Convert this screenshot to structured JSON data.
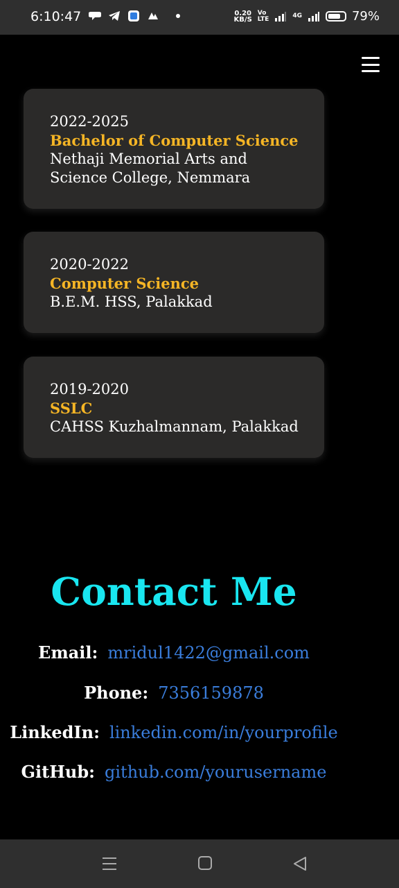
{
  "status_bar": {
    "time": "6:10:47",
    "speed_value": "0.20",
    "speed_unit": "KB/S",
    "volte_top": "Vo",
    "volte_bottom": "LTE",
    "network": "4G",
    "battery_percent": "79%",
    "battery_level": 0.79,
    "icons": [
      "chat-icon",
      "telegram-icon",
      "app-icon",
      "vpn-icon",
      "notification-dot"
    ]
  },
  "header": {
    "menu_icon": "hamburger-menu-icon"
  },
  "education": [
    {
      "year": "2022-2025",
      "degree": "Bachelor of Computer Science",
      "school_line1": "Nethaji Memorial Arts and",
      "school_line2": "Science College, Nemmara"
    },
    {
      "year": "2020-2022",
      "degree": "Computer Science",
      "school_line1": "B.E.M. HSS, Palakkad"
    },
    {
      "year": "2019-2020",
      "degree": "SSLC",
      "school_line1": "CAHSS Kuzhalmannam, Palakkad"
    }
  ],
  "contact": {
    "title": "Contact Me",
    "email_label": "Email:",
    "email_value": "mridul1422@gmail.com",
    "phone_label": "Phone:",
    "phone_value": "7356159878",
    "linkedin_label": "LinkedIn:",
    "linkedin_value": "linkedin.com/in/yourprofile",
    "github_label": "GitHub:",
    "github_value": "github.com/yourusername"
  },
  "colors": {
    "accent_cyan": "#19e6f0",
    "degree_gold": "#f5b525",
    "link_blue": "#3a7ddb",
    "card_bg": "#2b2a29"
  },
  "nav_bar": {
    "icons": [
      "recent-apps-icon",
      "home-icon",
      "back-icon"
    ]
  }
}
